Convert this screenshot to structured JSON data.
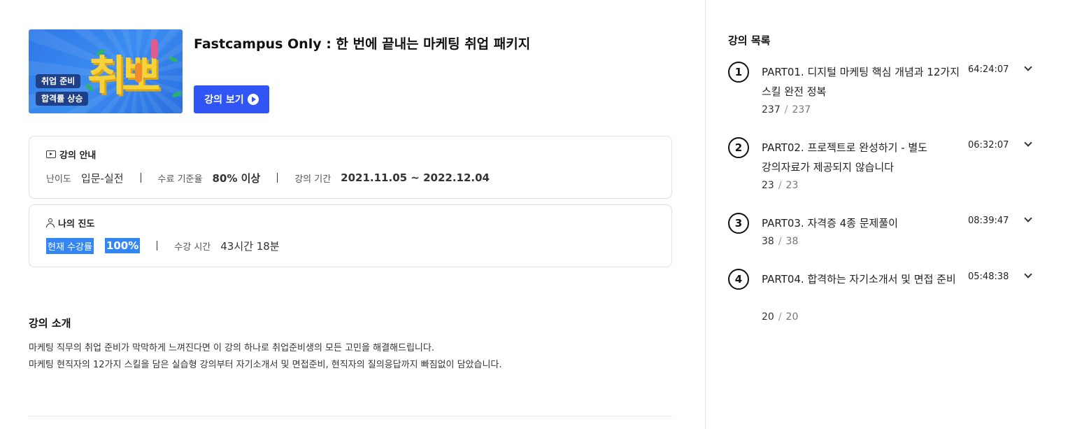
{
  "course": {
    "title": "Fastcampus Only : 한 번에 끝내는 마케팅 취업 패키지",
    "watch_button": "강의 보기",
    "thumbnail": {
      "big_text": "취뽀",
      "tag1": "취업 준비",
      "tag2": "합격률 상승"
    }
  },
  "info": {
    "heading": "강의 안내",
    "difficulty_label": "난이도",
    "difficulty_value": "입문-실전",
    "completion_label": "수료 기준율",
    "completion_value": "80% 이상",
    "period_label": "강의 기간",
    "period_value": "2021.11.05 ~ 2022.12.04"
  },
  "progress": {
    "heading": "나의 진도",
    "rate_label": "현재 수강률",
    "rate_value": "100%",
    "time_label": "수강 시간",
    "time_value": "43시간 18분"
  },
  "intro": {
    "heading": "강의 소개",
    "line1": " 마케팅 직무의 취업 준비가 막막하게 느껴진다면 이 강의 하나로 취업준비생의 모든 고민을 해결해드립니다.",
    "line2": "마케팅 현직자의 12가지 스킬을 담은 실습형 강의부터 자기소개서 및 면접준비, 현직자의 질의응답까지 빠짐없이 담았습니다."
  },
  "sidebar": {
    "title": "강의 목록",
    "parts": [
      {
        "num": "1",
        "title": "PART01. 디지털 마케팅 핵심 개념과 12가지 스킬 완전 정복",
        "duration": "64:24:07",
        "done": "237",
        "total": "237"
      },
      {
        "num": "2",
        "title": "PART02. 프로젝트로 완성하기 - 별도 강의자료가 제공되지 않습니다",
        "duration": "06:32:07",
        "done": "23",
        "total": "23"
      },
      {
        "num": "3",
        "title": "PART03. 자격증 4종 문제풀이",
        "duration": "08:39:47",
        "done": "38",
        "total": "38"
      },
      {
        "num": "4",
        "title": "PART04. 합격하는 자기소개서 및 면접 준비",
        "duration": "05:48:38",
        "done": "20",
        "total": "20"
      }
    ]
  },
  "colors": {
    "accent": "#2f55f5",
    "highlight": "#3586f5"
  }
}
